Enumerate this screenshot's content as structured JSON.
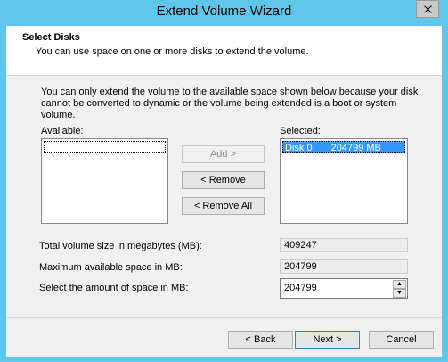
{
  "window": {
    "title": "Extend Volume Wizard",
    "close_icon": "close-icon"
  },
  "header": {
    "title": "Select Disks",
    "subtitle": "You can use space on one or more disks to extend the volume."
  },
  "intro_text": "You can only extend the volume to the available space shown below because your disk cannot be converted to dynamic or the volume being extended is a boot or system volume.",
  "available": {
    "label": "Available:",
    "items": []
  },
  "selected": {
    "label": "Selected:",
    "items": [
      {
        "disk": "Disk 0",
        "size": "204799 MB"
      }
    ]
  },
  "buttons": {
    "add": "Add >",
    "remove": "< Remove",
    "remove_all": "< Remove All"
  },
  "fields": {
    "total_label": "Total volume size in megabytes (MB):",
    "total_value": "409247",
    "max_label": "Maximum available space in MB:",
    "max_value": "204799",
    "amount_label": "Select the amount of space in MB:",
    "amount_value": "204799"
  },
  "footer": {
    "back": "< Back",
    "next": "Next >",
    "cancel": "Cancel"
  }
}
